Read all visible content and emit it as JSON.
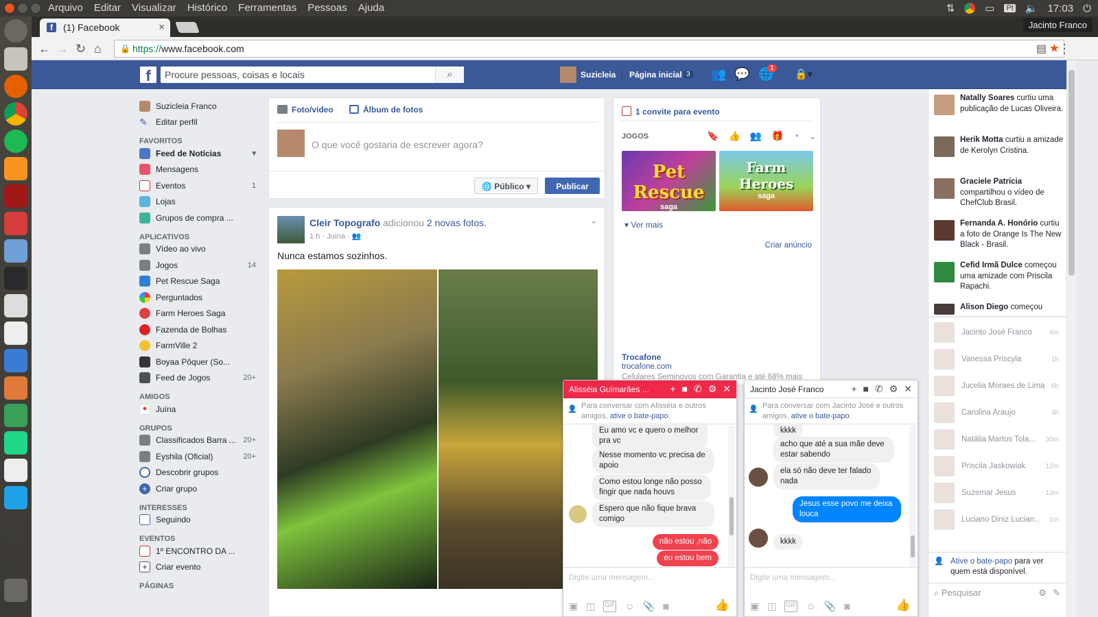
{
  "os": {
    "menu": [
      "Arquivo",
      "Editar",
      "Visualizar",
      "Histórico",
      "Ferramentas",
      "Pessoas",
      "Ajuda"
    ],
    "clock": "17:03",
    "keyboard": "Pt",
    "user": "Jacinto Franco"
  },
  "browser": {
    "tab_title": "(1) Facebook",
    "url_scheme": "https://",
    "url_host": "www.facebook.com"
  },
  "fb_header": {
    "search_placeholder": "Procure pessoas, coisas e locais",
    "profile_name": "Suzicleia",
    "home_label": "Página inicial",
    "home_count": "3",
    "notif_count": "1"
  },
  "leftnav": {
    "profile": "Suzicleia Franco",
    "edit_profile": "Editar perfil",
    "favorites_title": "FAVORITOS",
    "favorites": [
      {
        "label": "Feed de Notícias",
        "count": ""
      },
      {
        "label": "Mensagens",
        "count": ""
      },
      {
        "label": "Eventos",
        "count": "1"
      },
      {
        "label": "Lojas",
        "count": ""
      },
      {
        "label": "Grupos de compra ...",
        "count": ""
      }
    ],
    "apps_title": "APLICATIVOS",
    "apps": [
      {
        "label": "Vídeo ao vivo",
        "count": ""
      },
      {
        "label": "Jogos",
        "count": "14"
      },
      {
        "label": "Pet Rescue Saga",
        "count": ""
      },
      {
        "label": "Perguntados",
        "count": ""
      },
      {
        "label": "Farm Heroes Saga",
        "count": ""
      },
      {
        "label": "Fazenda de Bolhas",
        "count": ""
      },
      {
        "label": "FarmVille 2",
        "count": ""
      },
      {
        "label": "Boyaa Pôquer (So...",
        "count": ""
      },
      {
        "label": "Feed de Jogos",
        "count": "20+"
      }
    ],
    "friends_title": "AMIGOS",
    "friends": [
      {
        "label": "Juína",
        "count": ""
      }
    ],
    "groups_title": "GRUPOS",
    "groups": [
      {
        "label": "Classificados Barra ...",
        "count": "20+"
      },
      {
        "label": "Eyshila (Oficial)",
        "count": "20+"
      },
      {
        "label": "Descobrir grupos",
        "count": ""
      },
      {
        "label": "Criar grupo",
        "count": ""
      }
    ],
    "interests_title": "INTERESSES",
    "interests": [
      {
        "label": "Seguindo",
        "count": ""
      }
    ],
    "events_title": "EVENTOS",
    "events": [
      {
        "label": "1º ENCONTRO DA ...",
        "count": ""
      },
      {
        "label": "Criar evento",
        "count": ""
      }
    ],
    "pages_title": "PÁGINAS"
  },
  "composer": {
    "photo_video": "Foto/vídeo",
    "album": "Álbum de fotos",
    "placeholder": "O que você gostaria de escrever agora?",
    "privacy": "Público",
    "publish": "Publicar"
  },
  "post": {
    "author": "Cleir Topografo",
    "action": "adicionou",
    "target": "2 novas fotos.",
    "time": "1 h",
    "place": "Juína",
    "text": "Nunca estamos sozinhos."
  },
  "rightcol": {
    "event_invite": "1 convite para evento",
    "games_title": "JOGOS",
    "game1": "Pet Rescue",
    "game1_sub": "saga",
    "game2": "Farm Heroes",
    "game2_sub": "saga",
    "see_more": "Ver mais",
    "create_ad": "Criar anúncio",
    "ad_title": "Trocafone",
    "ad_url": "trocafone.com",
    "ad_text": "Celulares Seminovos com Garantia e até 68% mais"
  },
  "ticker": {
    "items": [
      {
        "name": "Natally Soares",
        "text": "curtiu uma publicação de Lucas Oliveira."
      },
      {
        "name": "Herik Motta",
        "text": "curtiu a amizade de Kerolyn Cristina."
      },
      {
        "name": "Graciele Patricia",
        "text": "compartilhou o vídeo de ChefClub Brasil."
      },
      {
        "name": "Fernanda A. Honório",
        "text": "curtiu a foto de Orange Is The New Black - Brasil."
      },
      {
        "name": "Cefid Irmã Dulce",
        "text": "começou uma amizade com Priscila Rapachi."
      },
      {
        "name": "Alison Diego",
        "text": "começou"
      }
    ],
    "friends": [
      {
        "name": "Jacinto José Franco",
        "time": "4m"
      },
      {
        "name": "Vanessa Priscyla",
        "time": "1h"
      },
      {
        "name": "Jucelia Moraes de Lima",
        "time": "6h"
      },
      {
        "name": "Carolina Araujo",
        "time": "4h"
      },
      {
        "name": "Natália Martos Tola...",
        "time": "30m"
      },
      {
        "name": "Priscila Jaskowiak",
        "time": "12m"
      },
      {
        "name": "Suzemar Jesus",
        "time": "13m"
      },
      {
        "name": "Luciano Diniz Lucian...",
        "time": "1m"
      }
    ],
    "activate_link": "Ative o bate-papo",
    "activate_text": "para ver quem está disponível.",
    "search": "Pesquisar"
  },
  "chat1": {
    "title": "Alisséia Guimarães ...",
    "notice": "Para conversar com Alisséia e outros amigos,",
    "notice_link": "ative o bate-papo",
    "messages": [
      "Eu amo vc e quero o melhor pra vc",
      "Nesse momento vc precisa de apoio",
      "Como estou longe não posso fingir que nada houvs",
      "Espero que não fique brava comigo"
    ],
    "out1": "não estou ,não",
    "out2": "eu estou bem",
    "input": "Digite uma mensagem..."
  },
  "chat2": {
    "title": "Jacinto José Franco",
    "notice": "Para conversar com Jacinto José e outros amigos,",
    "notice_link": "ative o bate-papo",
    "in1": "kkkk",
    "in2": "acho que até a sua mãe deve estar sabendo",
    "in3": "ela só não deve ter falado nada",
    "out1": "Jesus  esse povo me deixa louca",
    "in4": "kkkk",
    "input": "Digite uma mensagem..."
  },
  "colors": {
    "fb_blue": "#3b5998",
    "link": "#365899",
    "messenger_blue": "#0084ff",
    "chat_red": "#f02849",
    "chat_out_red": "#f0424f"
  }
}
